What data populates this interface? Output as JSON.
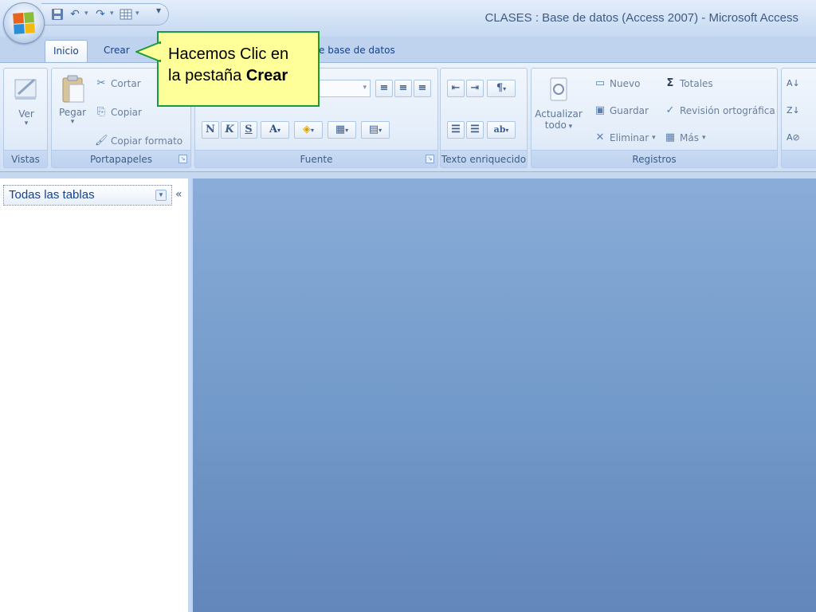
{
  "window": {
    "title": "CLASES : Base de datos (Access 2007) - Microsoft Access"
  },
  "qat": {
    "save_icon": "save-icon",
    "undo_icon": "undo-icon",
    "redo_icon": "redo-icon",
    "view_icon": "table-icon",
    "more_icon": "customize-icon"
  },
  "tabs": {
    "inicio": "Inicio",
    "crear": "Crear",
    "herramientas": "e base de datos"
  },
  "ribbon": {
    "vistas": {
      "label": "Vistas",
      "ver": "Ver"
    },
    "portapapeles": {
      "label": "Portapapeles",
      "pegar": "Pegar",
      "cortar": "Cortar",
      "copiar": "Copiar",
      "copiar_formato": "Copiar formato"
    },
    "fuente": {
      "label": "Fuente",
      "bold": "N",
      "italic": "K",
      "underline": "S"
    },
    "texto": {
      "label": "Texto enriquecido"
    },
    "registros": {
      "label": "Registros",
      "actualizar_line1": "Actualizar",
      "actualizar_line2": "todo",
      "nuevo": "Nuevo",
      "guardar": "Guardar",
      "eliminar": "Eliminar",
      "totales": "Totales",
      "revision": "Revisión ortográfica",
      "mas": "Más"
    }
  },
  "navpane": {
    "header": "Todas las tablas",
    "collapse": "«"
  },
  "callout": {
    "line1": "Hacemos Clic en",
    "line2_prefix": "la pestaña ",
    "line2_bold": "Crear"
  },
  "colors": {
    "callout_bg": "#ffff99",
    "callout_border": "#1a9a3a",
    "workspace": "#7199c9"
  }
}
